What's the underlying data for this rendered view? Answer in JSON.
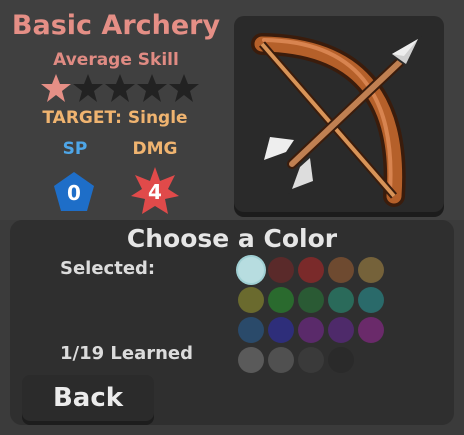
{
  "skill": {
    "title": "Basic Archery",
    "level": "Average Skill",
    "stars_filled": 1,
    "stars_total": 5,
    "target_text": "TARGET: Single",
    "sp_label": "SP",
    "dmg_label": "DMG",
    "sp_value": "0",
    "dmg_value": "4",
    "icon": "bow-and-arrow-icon"
  },
  "colors": {
    "title": "Choose a Color",
    "selected_label": "Selected:",
    "learned_label": "1/19 Learned",
    "swatches": [
      "#b7dde0",
      "#5a2a2a",
      "#7a2a2a",
      "#6e4a30",
      "#75623a",
      "#6a6a2e",
      "#2a6a2e",
      "#2a5a34",
      "#2a6a5a",
      "#2a6a6a",
      "#2a4a6a",
      "#2e2e7a",
      "#5a2a6a",
      "#4e2a6a",
      "#6a2a6a",
      "#5a5a5a",
      "#505050",
      "#3a3a3a",
      "#2a2a2a"
    ]
  },
  "back_label": "Back",
  "palette": {
    "title_color": "#e58f86",
    "target_color": "#f0b470",
    "sp_color": "#4ea6e8",
    "dmg_badge": "#e04a4a",
    "sp_badge": "#1e6ec8"
  }
}
